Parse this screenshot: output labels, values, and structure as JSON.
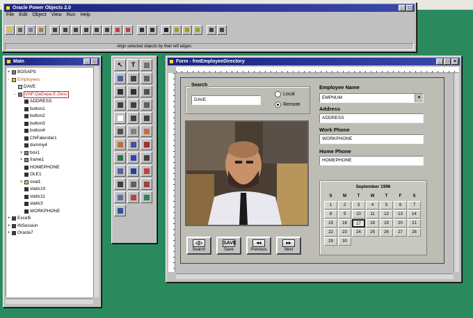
{
  "main_window": {
    "title": "Oracle Power Objects 2.0",
    "menu": [
      "File",
      "Edit",
      "Object",
      "View",
      "Run",
      "Help"
    ],
    "status_text": "Align selected objects by their left edges",
    "toolbar_icons": [
      {
        "name": "save-icon",
        "color": "#e0c040"
      },
      {
        "name": "cut-icon",
        "color": "#606060"
      },
      {
        "name": "copy-icon",
        "color": "#7080a0"
      },
      {
        "name": "paste-icon",
        "color": "#a08050"
      },
      {
        "name": "align-left-icon",
        "color": "#404040"
      },
      {
        "name": "align-right-icon",
        "color": "#404040"
      },
      {
        "name": "align-top-icon",
        "color": "#404040"
      },
      {
        "name": "align-bottom-icon",
        "color": "#404040"
      },
      {
        "name": "align-center-icon",
        "color": "#404040"
      },
      {
        "name": "space-evenly-icon",
        "color": "#404040"
      },
      {
        "name": "bring-front-icon",
        "color": "#c04040"
      },
      {
        "name": "send-back-icon",
        "color": "#c04040"
      },
      {
        "name": "run-form-icon",
        "color": "#303030"
      },
      {
        "name": "debug-icon",
        "color": "#303030"
      },
      {
        "name": "property-sheet-icon",
        "color": "#202020"
      },
      {
        "name": "object-list-icon",
        "color": "#a0a020"
      },
      {
        "name": "table-browse-icon",
        "color": "#a0a020"
      },
      {
        "name": "query-icon",
        "color": "#a0a020"
      },
      {
        "name": "help-index-icon",
        "color": "#404040"
      },
      {
        "name": "help-context-icon",
        "color": "#404040"
      }
    ]
  },
  "object_window": {
    "title": "Main",
    "items": [
      {
        "label": "BOSAPS",
        "indent": 0,
        "icon": "form-icon",
        "color": "#808080",
        "toggle": "+"
      },
      {
        "label": "Employees",
        "indent": 0,
        "icon": "folder-icon",
        "color": "#e0c040",
        "toggle": "-",
        "highlight": "orange"
      },
      {
        "label": "DAVE",
        "indent": 1,
        "icon": "database-icon",
        "color": "#c0c0c0",
        "toggle": ""
      },
      {
        "label": "VNF.QaDepa.E.Desc",
        "indent": 1,
        "icon": "form-icon",
        "color": "#808080",
        "toggle": "-",
        "selected": true
      },
      {
        "label": "ADDRESS",
        "indent": 2,
        "icon": "field-icon",
        "color": "#303030",
        "toggle": ""
      },
      {
        "label": "button1",
        "indent": 2,
        "icon": "button-icon",
        "color": "#303030",
        "toggle": ""
      },
      {
        "label": "button2",
        "indent": 2,
        "icon": "button-icon",
        "color": "#303030",
        "toggle": ""
      },
      {
        "label": "button3",
        "indent": 2,
        "icon": "button-icon",
        "color": "#303030",
        "toggle": ""
      },
      {
        "label": "button4",
        "indent": 2,
        "icon": "button-icon",
        "color": "#303030",
        "toggle": ""
      },
      {
        "label": "CNFalendar1",
        "indent": 2,
        "icon": "calendar-icon",
        "color": "#303030",
        "toggle": ""
      },
      {
        "label": "dummy4",
        "indent": 2,
        "icon": "text-icon",
        "color": "#303030",
        "toggle": ""
      },
      {
        "label": "box1",
        "indent": 2,
        "icon": "box-icon",
        "color": "#808080",
        "toggle": "+"
      },
      {
        "label": "frame1",
        "indent": 2,
        "icon": "frame-icon",
        "color": "#808080",
        "toggle": "+"
      },
      {
        "label": "HOMEPHONE",
        "indent": 2,
        "icon": "field-icon",
        "color": "#303030",
        "toggle": ""
      },
      {
        "label": "OLE1",
        "indent": 2,
        "icon": "ole-icon",
        "color": "#303030",
        "toggle": ""
      },
      {
        "label": "oval1",
        "indent": 2,
        "icon": "oval-icon",
        "color": "#e0c040",
        "toggle": "+"
      },
      {
        "label": "static10",
        "indent": 2,
        "icon": "text-icon",
        "color": "#303030",
        "toggle": ""
      },
      {
        "label": "static11",
        "indent": 2,
        "icon": "text-icon",
        "color": "#303030",
        "toggle": ""
      },
      {
        "label": "static3",
        "indent": 2,
        "icon": "text-icon",
        "color": "#303030",
        "toggle": ""
      },
      {
        "label": "WORKPHONE",
        "indent": 2,
        "icon": "field-icon",
        "color": "#303030",
        "toggle": ""
      },
      {
        "label": "Excel5",
        "indent": 0,
        "icon": "database-icon",
        "color": "#404040",
        "toggle": "+"
      },
      {
        "label": "INSession",
        "indent": 0,
        "icon": "database-icon",
        "color": "#404040",
        "toggle": "+"
      },
      {
        "label": "Oracle7",
        "indent": 0,
        "icon": "database-icon",
        "color": "#404040",
        "toggle": "+"
      }
    ]
  },
  "palette": {
    "tools": [
      {
        "name": "pointer-icon",
        "glyph": "↖",
        "color": ""
      },
      {
        "name": "text-tool-icon",
        "glyph": "T",
        "color": ""
      },
      {
        "name": "image-tool-icon",
        "glyph": "",
        "color": "#707070"
      },
      {
        "name": "ole-tool-icon",
        "glyph": "",
        "color": "#5060a0"
      },
      {
        "name": "pencil-tool-icon",
        "glyph": "",
        "color": "#404040"
      },
      {
        "name": "picture-tool-icon",
        "glyph": "",
        "color": "#606060"
      },
      {
        "name": "radio-tool-icon",
        "glyph": "",
        "color": "#303030"
      },
      {
        "name": "checkbox-tool-icon",
        "glyph": "",
        "color": "#303030"
      },
      {
        "name": "button-tool-icon",
        "glyph": "",
        "color": "#505050"
      },
      {
        "name": "combo-tool-icon",
        "glyph": "",
        "color": "#404040"
      },
      {
        "name": "line-tool-icon",
        "glyph": "",
        "color": "#404040"
      },
      {
        "name": "scrollbar-tool-icon",
        "glyph": "",
        "color": "#606060"
      },
      {
        "name": "field-tool-icon",
        "glyph": "",
        "color": "#ffffff"
      },
      {
        "name": "slider-tool-icon",
        "glyph": "",
        "color": "#404040"
      },
      {
        "name": "list-tool-icon",
        "glyph": "",
        "color": "#404040"
      },
      {
        "name": "repeater-tool-icon",
        "glyph": "",
        "color": "#505050"
      },
      {
        "name": "grid-tool-icon",
        "glyph": "",
        "color": "#808080"
      },
      {
        "name": "chart-tool-icon",
        "glyph": "",
        "color": "#c07040"
      },
      {
        "name": "embedded-form-icon",
        "glyph": "",
        "color": "#c07040"
      },
      {
        "name": "box-tool-icon",
        "glyph": "",
        "color": "#4050a0"
      },
      {
        "name": "report-tool-icon",
        "glyph": "",
        "color": "#a03030"
      },
      {
        "name": "tab-tool-icon",
        "glyph": "",
        "color": "#307050"
      },
      {
        "name": "frame-tool-icon",
        "glyph": "",
        "color": "#3040c0"
      },
      {
        "name": "color-tool-icon",
        "glyph": "",
        "color": "#404040"
      },
      {
        "name": "vbx-tool-icon",
        "glyph": "",
        "color": "#5060a0"
      },
      {
        "name": "globe-tool-icon",
        "glyph": "",
        "color": "#2040a0"
      },
      {
        "name": "graph-tool-icon",
        "glyph": "",
        "color": "#c04040"
      },
      {
        "name": "oval-tool-icon",
        "glyph": "",
        "color": "#404040"
      },
      {
        "name": "arrow-tool-icon",
        "glyph": "",
        "color": "#606060"
      },
      {
        "name": "calendar-tool-icon",
        "glyph": "",
        "color": "#a04040"
      },
      {
        "name": "misc-tool-icon",
        "glyph": "",
        "color": "#6070a0"
      },
      {
        "name": "picture2-tool-icon",
        "glyph": "",
        "color": "#c04040"
      },
      {
        "name": "extra-tool-icon",
        "glyph": "",
        "color": "#308060"
      },
      {
        "name": "help-tool-icon",
        "glyph": "",
        "color": "#3050a0"
      }
    ]
  },
  "form_window": {
    "title": "Form - frmEmployeeDirectory",
    "search": {
      "label": "Search",
      "value": "DAVE",
      "radio_local": "Local",
      "radio_remote": "Remote"
    },
    "fields": {
      "employee_name_label": "Employee Name",
      "employee_name": "EMPNUM",
      "address_label": "Address",
      "address": "ADDRESS",
      "work_phone_label": "Work Phone",
      "work_phone": "WORKPHONE",
      "home_phone_label": "Home Phone",
      "home_phone": "HOMEPHONE"
    },
    "nav_buttons": [
      {
        "label": "Search",
        "glyph": "◁▷"
      },
      {
        "label": "Save",
        "glyph": "SAVE"
      },
      {
        "label": "Previous",
        "glyph": "◂◂"
      },
      {
        "label": "Next",
        "glyph": "▸▸"
      }
    ],
    "calendar": {
      "title": "September 1996",
      "dow": [
        "S",
        "M",
        "T",
        "W",
        "T",
        "F",
        "S"
      ],
      "days": [
        "1",
        "2",
        "3",
        "4",
        "5",
        "6",
        "7",
        "8",
        "9",
        "10",
        "11",
        "12",
        "13",
        "14",
        "15",
        "16",
        "17",
        "18",
        "19",
        "20",
        "21",
        "22",
        "23",
        "24",
        "25",
        "26",
        "27",
        "28",
        "29",
        "30"
      ],
      "selected_day": "17"
    }
  }
}
